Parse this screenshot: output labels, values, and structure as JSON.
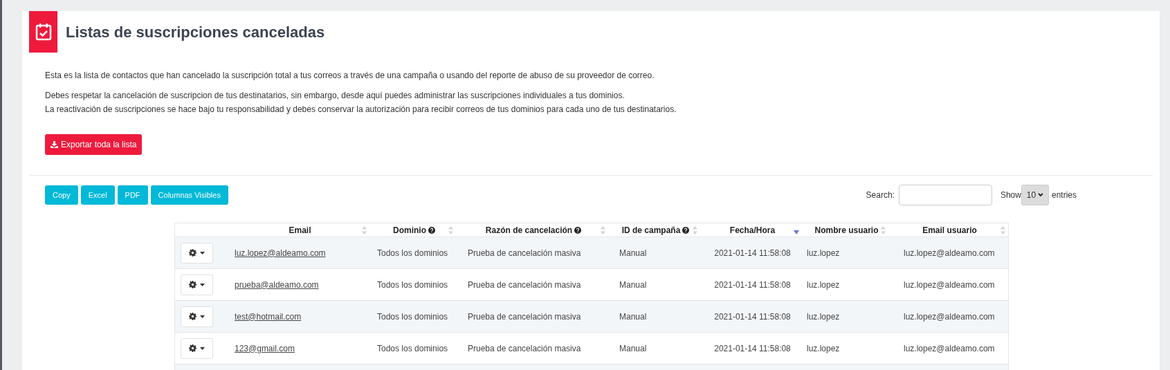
{
  "header": {
    "title": "Listas de suscripciones canceladas"
  },
  "description": [
    "Esta es la lista de contactos que han cancelado la suscripción total a tus correos a través de una campaña o usando del reporte de abuso de su proveedor de correo.",
    "Debes respetar la cancelación de suscripcion de tus destinatarios, sin embargo, desde aquí puedes administrar las suscripciones individuales a tus dominios.",
    "La reactivación de suscripciones se hace bajo tu responsabilidad y debes conservar la autorización para recibir correos de tus dominios para cada uno de tus destinatarios."
  ],
  "export_button": "Exportar toda la lista",
  "toolbar_buttons": [
    "Copy",
    "Excel",
    "PDF",
    "Columnas Visibles"
  ],
  "search": {
    "label": "Search:"
  },
  "length": {
    "prefix": "Show",
    "value": "10",
    "suffix": "entries"
  },
  "table": {
    "columns": [
      {
        "sortable": false,
        "help": false
      },
      {
        "label": "Email",
        "sortable": true,
        "sorted_descending": false,
        "help": false
      },
      {
        "label": "Dominio",
        "sortable": true,
        "sorted_descending": false,
        "help": true
      },
      {
        "label": "Razón de cancelación",
        "sortable": true,
        "sorted_descending": false,
        "help": true
      },
      {
        "label": "ID de campaña",
        "sortable": true,
        "sorted_descending": false,
        "help": true
      },
      {
        "label": "Fecha/Hora",
        "sortable": true,
        "sorted_descending": true,
        "help": false
      },
      {
        "label": "Nombre usuario",
        "sortable": true,
        "sorted_descending": false,
        "help": false
      },
      {
        "label": "Email usuario",
        "sortable": true,
        "sorted_descending": false,
        "help": false
      }
    ],
    "rows": [
      {
        "email": "luz.lopez@aldeamo.com",
        "domain": "Todos los dominios",
        "reason": "Prueba de cancelación masiva",
        "campaign": "Manual",
        "date": "2021-01-14 11:58:08",
        "user": "luz.lopez",
        "user_email": "luz.lopez@aldeamo.com"
      },
      {
        "email": "prueba@aldeamo.com",
        "domain": "Todos los dominios",
        "reason": "Prueba de cancelación masiva",
        "campaign": "Manual",
        "date": "2021-01-14 11:58:08",
        "user": "luz.lopez",
        "user_email": "luz.lopez@aldeamo.com"
      },
      {
        "email": "test@hotmail.com",
        "domain": "Todos los dominios",
        "reason": "Prueba de cancelación masiva",
        "campaign": "Manual",
        "date": "2021-01-14 11:58:08",
        "user": "luz.lopez",
        "user_email": "luz.lopez@aldeamo.com"
      },
      {
        "email": "123@gmail.com",
        "domain": "Todos los dominios",
        "reason": "Prueba de cancelación masiva",
        "campaign": "Manual",
        "date": "2021-01-14 11:58:08",
        "user": "luz.lopez",
        "user_email": "luz.lopez@aldeamo.com"
      }
    ]
  }
}
